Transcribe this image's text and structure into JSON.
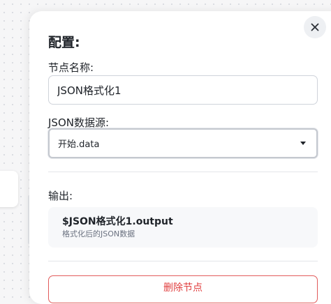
{
  "panel": {
    "title": "配置:",
    "name_field": {
      "label": "节点名称:",
      "value": "JSON格式化1"
    },
    "source_field": {
      "label": "JSON数据源:",
      "selected": "开始.data"
    },
    "output": {
      "label": "输出:",
      "variable": "$JSON格式化1.output",
      "description": "格式化后的JSON数据"
    },
    "delete_label": "删除节点"
  },
  "icons": {
    "close": "close-icon",
    "dropdown": "chevron-down-icon"
  },
  "colors": {
    "danger": "#e03e3e",
    "border": "#cfd3da",
    "card_bg": "#f7f8fa"
  }
}
